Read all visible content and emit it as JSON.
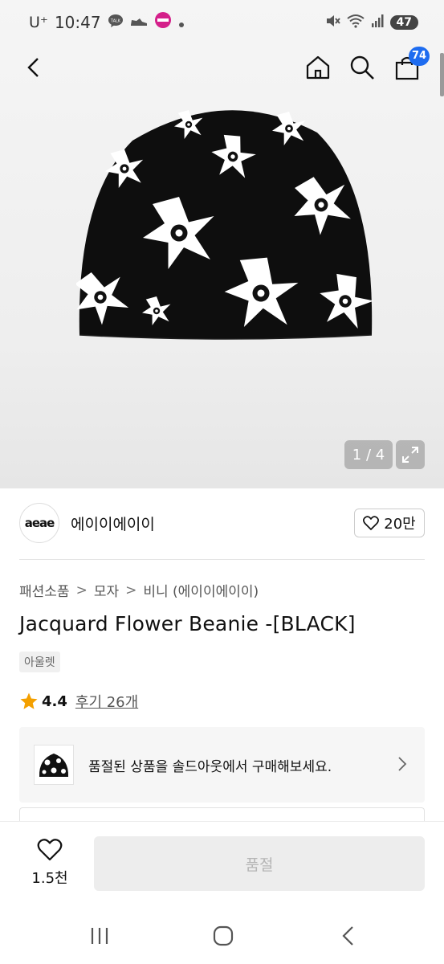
{
  "status": {
    "carrier": "U⁺",
    "time": "10:47",
    "battery": "47"
  },
  "nav": {
    "cart_badge": "74"
  },
  "gallery": {
    "counter": "1 / 4"
  },
  "brand": {
    "logo_text": "aeae",
    "name": "에이이에이이",
    "likes": "20만"
  },
  "breadcrumb": {
    "items": [
      "패션소품",
      "모자",
      "비니 (에이이에이이)"
    ],
    "separator": ">"
  },
  "product": {
    "title": "Jacquard Flower Beanie -[BLACK]",
    "tag": "아울렛",
    "rating": "4.4",
    "review_label": "후기 26개",
    "rating_color": "#f4a000"
  },
  "soldout_banner": {
    "text": "품절된 상품을 솔드아웃에서 구매해보세요."
  },
  "buybar": {
    "wish_count": "1.5천",
    "button_label": "품절"
  },
  "colors": {
    "accent": "#1e6cf0",
    "star": "#f4a000"
  }
}
